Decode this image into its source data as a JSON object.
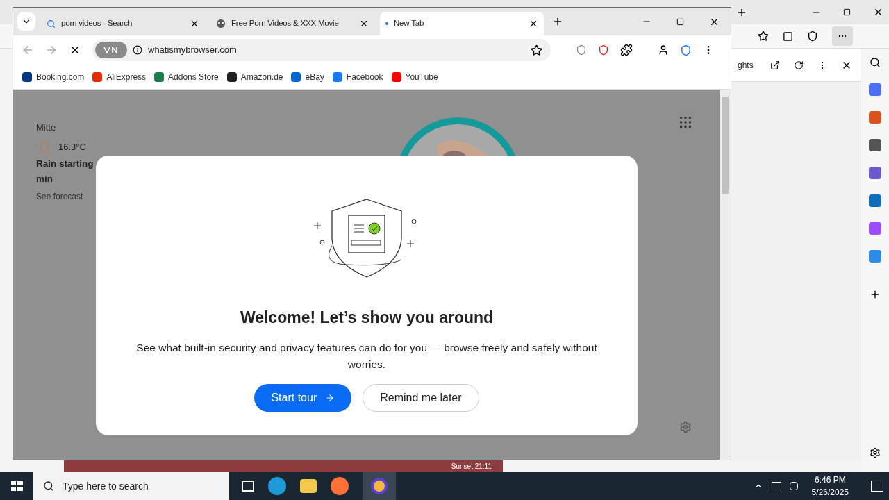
{
  "background_window": {
    "panel_title": "ghts",
    "sunset": "Sunset 21:11"
  },
  "tabs": [
    {
      "title": "porn videos - Search",
      "kind": "search",
      "selected": false
    },
    {
      "title": "Free Porn Videos & XXX Movie",
      "kind": "site",
      "selected": false
    },
    {
      "title": "New Tab",
      "kind": "loading",
      "selected": true
    }
  ],
  "address": "whatismybrowser.com",
  "bookmarks": [
    {
      "label": "Booking.com",
      "color": "#003580"
    },
    {
      "label": "AliExpress",
      "color": "#e62e04"
    },
    {
      "label": "Addons Store",
      "color": "#1a7f4b"
    },
    {
      "label": "Amazon.de",
      "color": "#222222"
    },
    {
      "label": "eBay",
      "color": "#0064d2"
    },
    {
      "label": "Facebook",
      "color": "#1877f2"
    },
    {
      "label": "YouTube",
      "color": "#ff0000"
    }
  ],
  "weather": {
    "location": "Mitte",
    "temperature": "16.3°C",
    "alert_lines": [
      "Rain starting",
      "min"
    ],
    "link": "See forecast"
  },
  "dialog": {
    "title": "Welcome! Let’s show you around",
    "text": "See what built-in security and privacy features can do for you — browse freely and safely without worries.",
    "primary": "Start tour",
    "secondary": "Remind me later"
  },
  "taskbar": {
    "search_placeholder": "Type here to search",
    "time": "6:46 PM",
    "date": "5/26/2025"
  }
}
